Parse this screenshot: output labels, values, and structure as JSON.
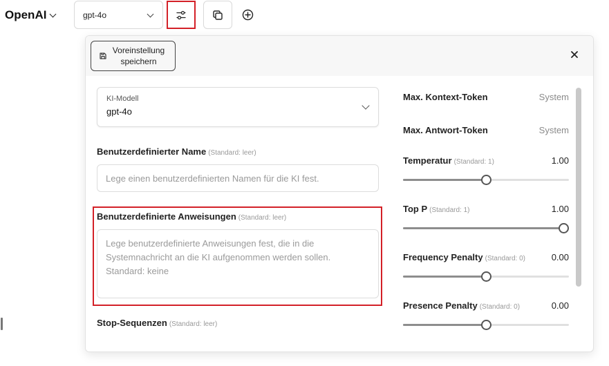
{
  "header": {
    "brand": "OpenAI",
    "model_value": "gpt-4o"
  },
  "panel": {
    "save_preset_label": "Voreinstellung speichern",
    "ki_model_label": "KI-Modell",
    "ki_model_value": "gpt-4o",
    "custom_name": {
      "label": "Benutzerdefinierter Name",
      "hint": "(Standard: leer)",
      "placeholder": "Lege einen benutzerdefinierten Namen für die KI fest."
    },
    "custom_instructions": {
      "label": "Benutzerdefinierte Anweisungen",
      "hint": "(Standard: leer)",
      "placeholder": "Lege benutzerdefinierte Anweisungen fest, die in die Systemnachricht an die KI aufgenommen werden sollen.\nStandard: keine"
    },
    "stop_sequences": {
      "label": "Stop-Sequenzen",
      "hint": "(Standard: leer)"
    },
    "params": {
      "max_context": {
        "label": "Max. Kontext-Token",
        "value": "System"
      },
      "max_response": {
        "label": "Max. Antwort-Token",
        "value": "System"
      },
      "temperature": {
        "label": "Temperatur",
        "hint": "(Standard: 1)",
        "value": "1.00",
        "fraction": 0.5
      },
      "top_p": {
        "label": "Top P",
        "hint": "(Standard: 1)",
        "value": "1.00",
        "fraction": 1.0
      },
      "frequency_penalty": {
        "label": "Frequency Penalty",
        "hint": "(Standard: 0)",
        "value": "0.00",
        "fraction": 0.5
      },
      "presence_penalty": {
        "label": "Presence Penalty",
        "hint": "(Standard: 0)",
        "value": "0.00",
        "fraction": 0.5
      }
    }
  },
  "icons": {
    "brand_chevron": "chevron-down-icon",
    "model_chevron": "chevron-down-icon",
    "settings": "sliders-icon",
    "copy": "copy-icon",
    "add": "plus-circle-icon",
    "save": "floppy-disk-icon",
    "close": "close-icon"
  },
  "colors": {
    "highlight": "#d32027",
    "slider_fill": "#8d8d8d",
    "slider_track": "#e0e0e0"
  }
}
